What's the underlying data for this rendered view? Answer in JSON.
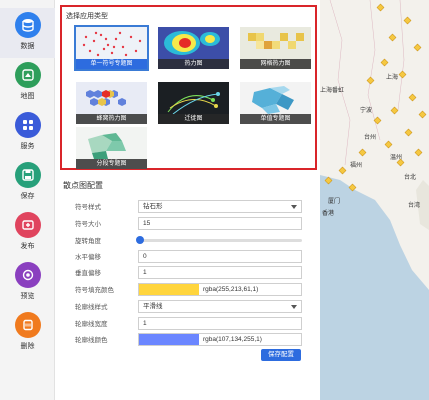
{
  "nav": {
    "items": [
      {
        "label": "数据",
        "icon": "database-icon",
        "color": "#2f80ed",
        "active": true
      },
      {
        "label": "地图",
        "icon": "map-icon",
        "color": "#2e9e5b",
        "active": false
      },
      {
        "label": "服务",
        "icon": "grid-icon",
        "color": "#3a5bd9",
        "active": false
      },
      {
        "label": "保存",
        "icon": "save-icon",
        "color": "#27a07a",
        "active": false
      },
      {
        "label": "发布",
        "icon": "publish-icon",
        "color": "#e0445e",
        "active": false
      },
      {
        "label": "预览",
        "icon": "preview-icon",
        "color": "#8a3fbf",
        "active": false
      },
      {
        "label": "删除",
        "icon": "delete-icon",
        "color": "#f07a1e",
        "active": false
      }
    ]
  },
  "app_types": {
    "title": "选择应用类型",
    "items": [
      {
        "label": "单一符号专题图",
        "selected": true
      },
      {
        "label": "热力图",
        "selected": false
      },
      {
        "label": "网格热力图",
        "selected": false
      },
      {
        "label": "蜂窝热力图",
        "selected": false
      },
      {
        "label": "迁徙图",
        "selected": false
      },
      {
        "label": "单值专题图",
        "selected": false
      },
      {
        "label": "分段专题图",
        "selected": false
      }
    ]
  },
  "config": {
    "title": "散点图配置",
    "symbol_style": {
      "label": "符号样式",
      "value": "钻石形"
    },
    "symbol_size": {
      "label": "符号大小",
      "value": "15"
    },
    "rotation": {
      "label": "旋转角度",
      "value": 0
    },
    "offset_h": {
      "label": "水平偏移",
      "value": "0"
    },
    "offset_v": {
      "label": "垂直偏移",
      "value": "1"
    },
    "fill_color": {
      "label": "符号填充颜色",
      "value": "rgba(255,213,61,1)",
      "swatch": "#ffd53d"
    },
    "line_style": {
      "label": "轮廓线样式",
      "value": "平滑线"
    },
    "line_width": {
      "label": "轮廓线宽度",
      "value": "1"
    },
    "line_color": {
      "label": "轮廓线颜色",
      "value": "rgba(107,134,255,1)",
      "swatch": "#6b86ff"
    },
    "save_label": "保存配置"
  },
  "map": {
    "labels": [
      "上海",
      "上海番虹",
      "宁波",
      "台州",
      "温州",
      "福州",
      "厦门",
      "香港",
      "台北",
      "台湾"
    ]
  }
}
